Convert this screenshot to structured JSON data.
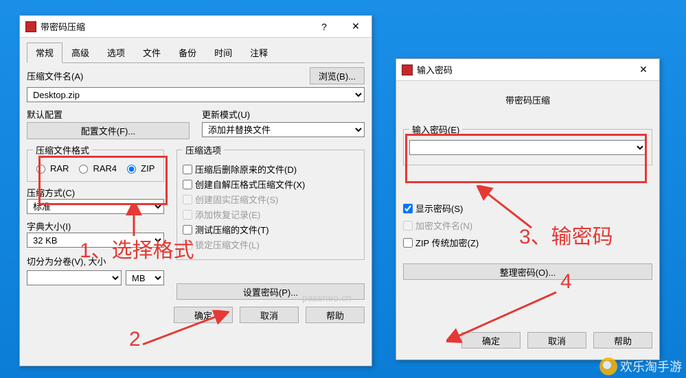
{
  "dialog1": {
    "title": "带密码压缩",
    "tabs": [
      "常规",
      "高级",
      "选项",
      "文件",
      "备份",
      "时间",
      "注释"
    ],
    "archive_name_label": "压缩文件名(A)",
    "browse_btn": "浏览(B)...",
    "archive_name_value": "Desktop.zip",
    "profile_label": "默认配置",
    "profile_btn": "配置文件(F)...",
    "update_mode_label": "更新模式(U)",
    "update_mode_value": "添加并替换文件",
    "format_label": "压缩文件格式",
    "format_options": {
      "rar": "RAR",
      "rar4": "RAR4",
      "zip": "ZIP"
    },
    "format_selected": "zip",
    "method_label": "压缩方式(C)",
    "method_value": "标准",
    "dict_label": "字典大小(I)",
    "dict_value": "32 KB",
    "split_label": "切分为分卷(V), 大小",
    "split_unit": "MB",
    "options_label": "压缩选项",
    "opt_delete": "压缩后删除原来的文件(D)",
    "opt_sfx": "创建自解压格式压缩文件(X)",
    "opt_solid": "创建固实压缩文件(S)",
    "opt_recovery": "添加恢复记录(E)",
    "opt_test": "测试压缩的文件(T)",
    "opt_lock": "锁定压缩文件(L)",
    "set_pwd_btn": "设置密码(P)...",
    "ok": "确定",
    "cancel": "取消",
    "help": "帮助"
  },
  "dialog2": {
    "title": "输入密码",
    "heading": "带密码压缩",
    "pwd_label": "输入密码(E)",
    "pwd_value": "",
    "show_pwd": "显示密码(S)",
    "encrypt_names": "加密文件名(N)",
    "zip_legacy": "ZIP 传统加密(Z)",
    "organize_btn": "整理密码(O)...",
    "ok": "确定",
    "cancel": "取消",
    "help": "帮助"
  },
  "annotations": {
    "step1": "1、选择格式",
    "step2": "2",
    "step3": "3、输密码",
    "step4": "4"
  },
  "watermark": "passneo.cn",
  "brand": "欢乐淘手游"
}
